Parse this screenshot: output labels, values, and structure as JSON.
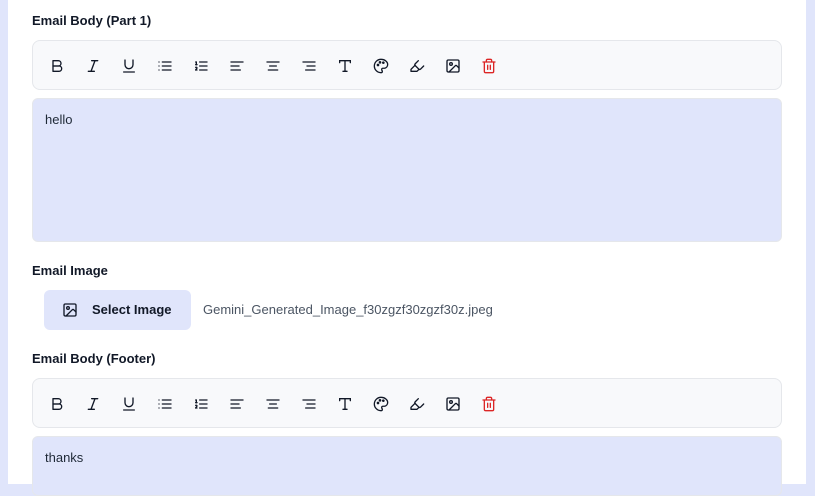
{
  "sections": {
    "body_part1": {
      "label": "Email Body (Part 1)",
      "content": "hello"
    },
    "image": {
      "label": "Email Image",
      "button_label": "Select Image",
      "filename": "Gemini_Generated_Image_f30zgzf30zgzf30z.jpeg"
    },
    "body_footer": {
      "label": "Email Body (Footer)",
      "content": "thanks"
    }
  },
  "toolbar": {
    "tools": [
      "bold-icon",
      "italic-icon",
      "underline-icon",
      "bullet-list-icon",
      "ordered-list-icon",
      "align-left-icon",
      "align-center-icon",
      "align-right-icon",
      "text-size-icon",
      "palette-icon",
      "highlighter-icon",
      "image-icon",
      "trash-icon"
    ]
  },
  "colors": {
    "page_background": "#e0e5fb",
    "editor_background": "#e0e5fb",
    "toolbar_background": "#f8f9fb",
    "delete_icon": "#dc2626"
  }
}
